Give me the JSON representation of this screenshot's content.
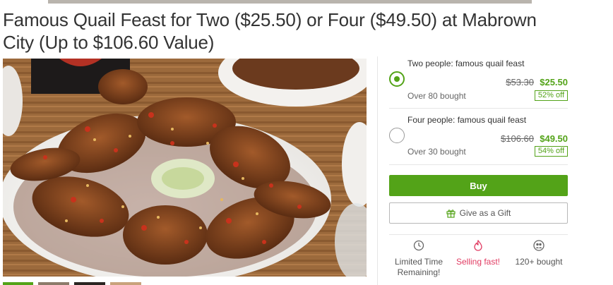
{
  "deal": {
    "title": "Famous Quail Feast for Two ($25.50) or Four ($49.50) at Mabrown City (Up to $106.60 Value)"
  },
  "options": [
    {
      "name": "Two people: famous quail feast",
      "original_price": "$53.30",
      "price": "$25.50",
      "bought": "Over 80 bought",
      "discount": "52% off",
      "selected": true
    },
    {
      "name": "Four people: famous quail feast",
      "original_price": "$106.60",
      "price": "$49.50",
      "bought": "Over 30 bought",
      "discount": "54% off",
      "selected": false
    }
  ],
  "actions": {
    "buy_label": "Buy",
    "gift_label": "Give as a Gift"
  },
  "stats": {
    "time_line1": "Limited Time",
    "time_line2": "Remaining!",
    "selling": "Selling fast!",
    "bought": "120+ bought"
  },
  "colors": {
    "accent_green": "#53a318",
    "hot_pink": "#e13b62"
  },
  "icons": {
    "gift": "gift-icon",
    "clock": "clock-icon",
    "flame": "flame-icon",
    "people": "people-icon",
    "radio": "radio-button"
  }
}
